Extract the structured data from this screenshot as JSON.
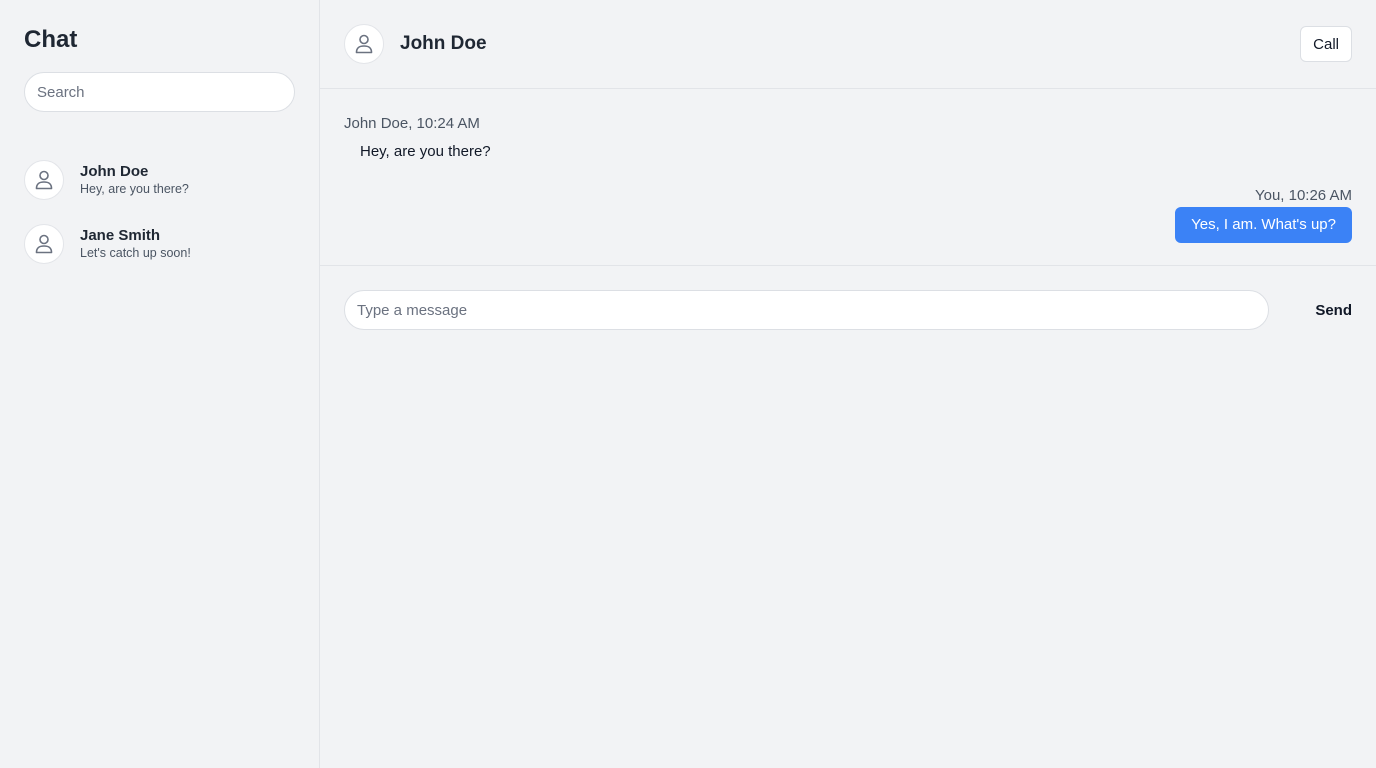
{
  "sidebar": {
    "title": "Chat",
    "search_placeholder": "Search",
    "contacts": [
      {
        "name": "John Doe",
        "preview": "Hey, are you there?",
        "icon": "user-icon"
      },
      {
        "name": "Jane Smith",
        "preview": "Let's catch up soon!",
        "icon": "user-icon"
      }
    ]
  },
  "header": {
    "contact_name": "John Doe",
    "call_label": "Call",
    "icon": "user-icon"
  },
  "messages": [
    {
      "direction": "incoming",
      "meta": "John Doe, 10:24 AM",
      "text": "Hey, are you there?"
    },
    {
      "direction": "outgoing",
      "meta": "You, 10:26 AM",
      "text": "Yes, I am. What's up?"
    }
  ],
  "composer": {
    "placeholder": "Type a message",
    "send_label": "Send"
  },
  "colors": {
    "accent": "#3b82f6",
    "background": "#f2f3f5",
    "border": "#e2e4e8"
  }
}
